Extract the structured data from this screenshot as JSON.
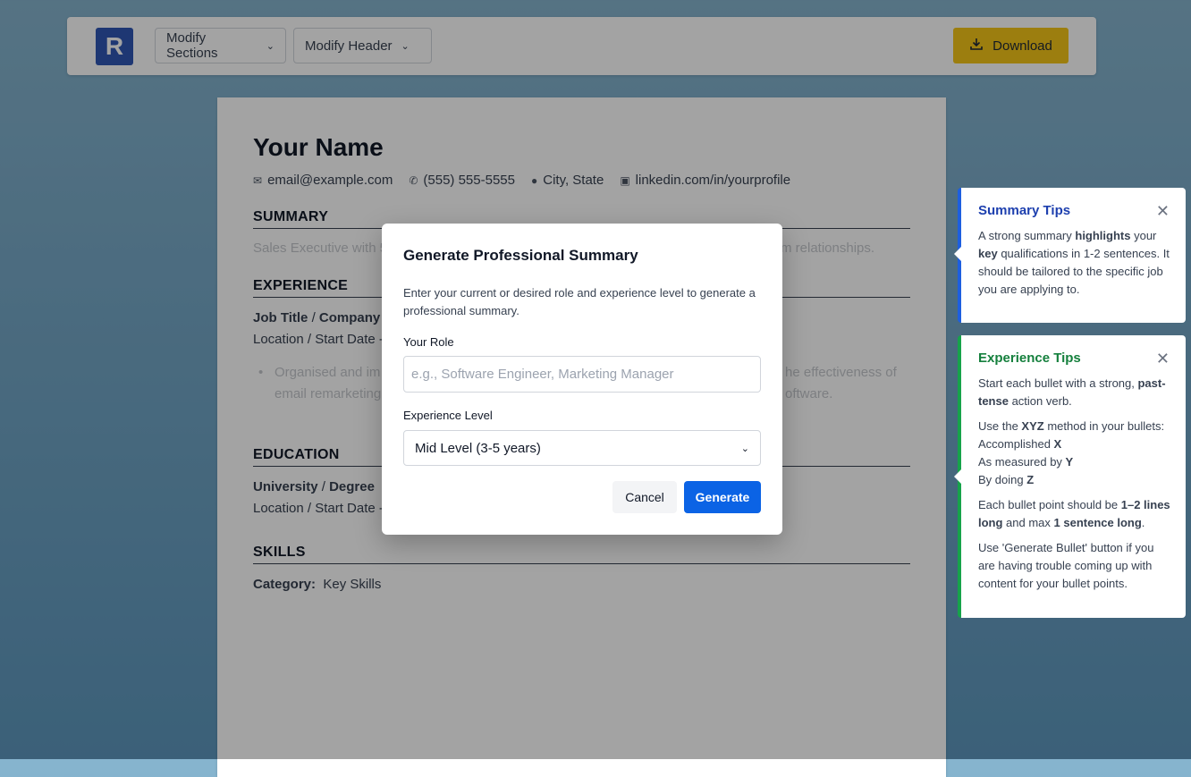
{
  "toolbar": {
    "logo": "R",
    "modify_sections": "Modify Sections",
    "modify_header": "Modify Header",
    "download": "Download"
  },
  "resume": {
    "name": "Your Name",
    "email": "email@example.com",
    "phone": "(555) 555-5555",
    "location": "City, State",
    "linkedin": "linkedin.com/in/yourprofile",
    "summary_title": "SUMMARY",
    "summary_text_left": "Sales Executive with 5",
    "summary_text_right": "m relationships.",
    "experience_title": "EXPERIENCE",
    "job_title": "Job Title",
    "job_company": "Company",
    "job_location": "Location / Start Date -",
    "bullet_left_1": "Organised and im",
    "bullet_left_2": "email remarketing",
    "bullet_right_1": "he effectiveness of",
    "bullet_right_2": "oftware.",
    "education_title": "EDUCATION",
    "university": "University",
    "degree": "Degree",
    "edu_location": "Location / Start Date -",
    "skills_title": "SKILLS",
    "skills_category": "Category:",
    "skills_value": "Key Skills"
  },
  "modal": {
    "title": "Generate Professional Summary",
    "description": "Enter your current or desired role and experience level to generate a professional summary.",
    "role_label": "Your Role",
    "role_placeholder": "e.g., Software Engineer, Marketing Manager",
    "level_label": "Experience Level",
    "level_selected": "Mid Level (3-5 years)",
    "cancel": "Cancel",
    "generate": "Generate"
  },
  "tips": {
    "summary": {
      "title": "Summary Tips",
      "close": "✕"
    },
    "experience": {
      "title": "Experience Tips",
      "close": "✕"
    }
  },
  "colors": {
    "accent_blue": "#0b63e5",
    "download_yellow": "#f5c518",
    "summary_tip_border": "#1d5fe0",
    "experience_tip_border": "#16a34a"
  }
}
